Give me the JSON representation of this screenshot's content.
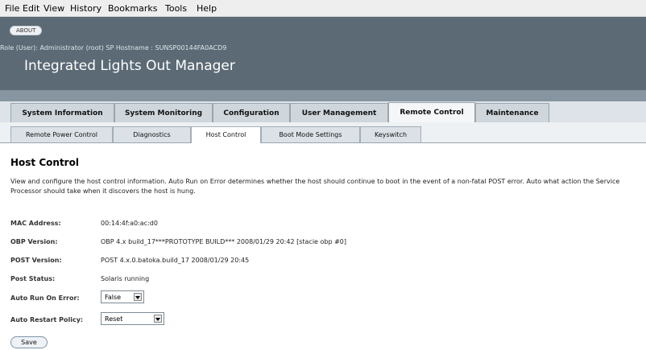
{
  "menubar": {
    "items": [
      "File",
      "Edit",
      "View",
      "History",
      "Bookmarks",
      "Tools",
      "Help"
    ]
  },
  "header": {
    "about_label": "ABOUT",
    "role_line": "Role (User): Administrator (root)  SP Hostname : SUNSP00144FA0ACD9",
    "app_title": "Integrated Lights Out Manager"
  },
  "main_tabs": [
    {
      "label": "System Information"
    },
    {
      "label": "System Monitoring"
    },
    {
      "label": "Configuration"
    },
    {
      "label": "User Management"
    },
    {
      "label": "Remote Control",
      "active": true
    },
    {
      "label": "Maintenance"
    }
  ],
  "sub_tabs": [
    {
      "label": "Remote Power Control"
    },
    {
      "label": "Diagnostics"
    },
    {
      "label": "Host Control",
      "active": true
    },
    {
      "label": "Boot Mode Settings"
    },
    {
      "label": "Keyswitch"
    }
  ],
  "page": {
    "title": "Host Control",
    "description": "View and configure the host control information. Auto Run on Error determines whether the host should continue to boot in the event of a non-fatal POST error. Auto what action the Service Processor should take when it discovers the host is hung."
  },
  "fields": {
    "mac": {
      "label": "MAC Address:",
      "value": "00:14:4f:a0:ac:d0"
    },
    "obp": {
      "label": "OBP Version:",
      "value": "OBP 4.x build_17***PROTOTYPE BUILD*** 2008/01/29 20:42 [stacie obp #0]"
    },
    "post": {
      "label": "POST Version:",
      "value": "POST 4.x.0.batoka.build_17 2008/01/29 20:45"
    },
    "status": {
      "label": "Post Status:",
      "value": "Solaris running"
    },
    "auto_run": {
      "label": "Auto Run On Error:",
      "value": "False"
    },
    "auto_restart": {
      "label": "Auto Restart Policy:",
      "value": "Reset"
    }
  },
  "save_label": "Save"
}
